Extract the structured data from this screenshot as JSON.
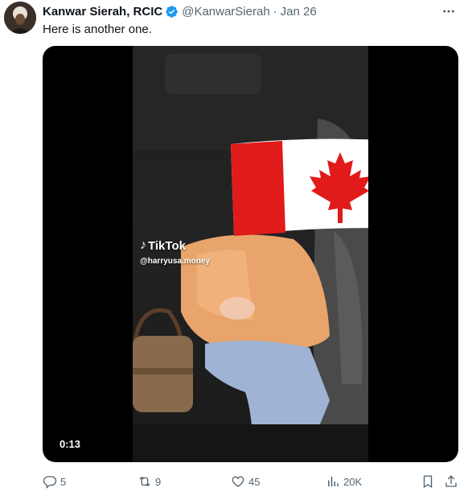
{
  "tweet": {
    "author_name": "Kanwar Sierah, RCIC",
    "handle": "@KanwarSierah",
    "separator": "·",
    "date": "Jan 26",
    "text": "Here is another one.",
    "verified_color": "#1d9bf0"
  },
  "media": {
    "watermark_brand": "TikTok",
    "watermark_user": "@harryusa.money",
    "video_time": "0:13"
  },
  "actions": {
    "replies": "5",
    "retweets": "9",
    "likes": "45",
    "views": "20K"
  },
  "icons": {
    "more": "more-dots-icon",
    "reply": "reply-icon",
    "retweet": "retweet-icon",
    "like": "heart-icon",
    "views": "views-icon",
    "bookmark": "bookmark-icon",
    "share": "share-icon"
  }
}
